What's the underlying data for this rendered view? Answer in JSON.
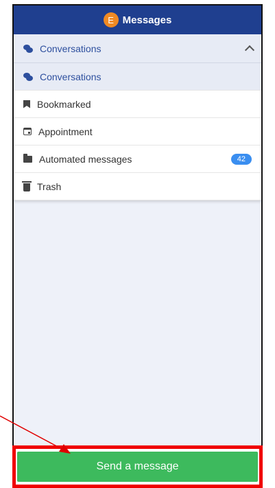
{
  "header": {
    "avatar_letter": "E",
    "title": "Messages"
  },
  "dropdown": {
    "label": "Conversations"
  },
  "menu": {
    "items": [
      {
        "label": "Conversations",
        "icon": "chat-icon",
        "active": true
      },
      {
        "label": "Bookmarked",
        "icon": "bookmark-icon"
      },
      {
        "label": "Appointment",
        "icon": "calendar-icon"
      },
      {
        "label": "Automated messages",
        "icon": "folder-icon",
        "badge": "42"
      },
      {
        "label": "Trash",
        "icon": "trash-icon"
      }
    ]
  },
  "footer": {
    "send_label": "Send a message"
  },
  "colors": {
    "header": "#1f3f8f",
    "accent": "#2d4f9e",
    "badge": "#3a8ef0",
    "send": "#3dba5d",
    "highlight": "#f00000"
  }
}
